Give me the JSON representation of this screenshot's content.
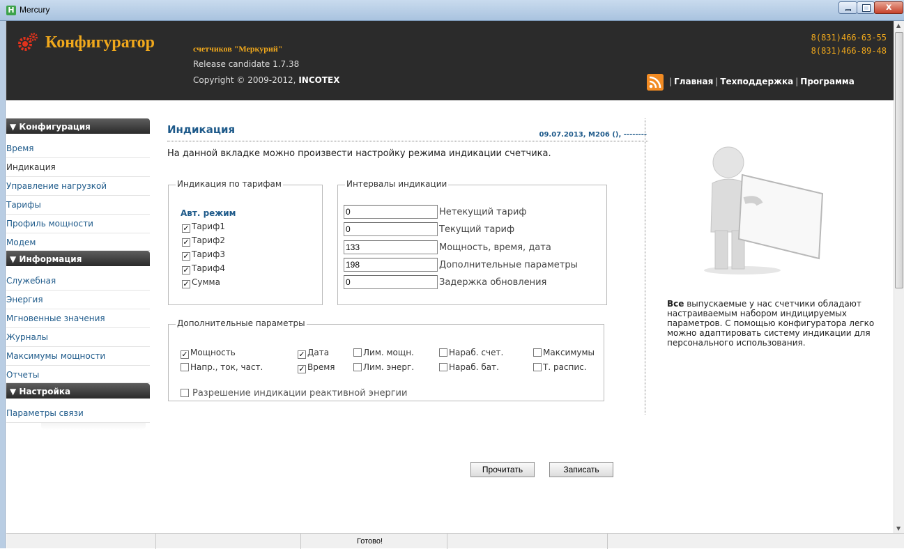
{
  "window": {
    "title": "Mercury",
    "app_icon_letter": "H"
  },
  "header": {
    "brand": "Конфигуратор",
    "brand_sub": "счетчиков \"Меркурий\"",
    "release": "Release candidate 1.7.38",
    "copyright_prefix": "Copyright © 2009-2012, ",
    "copyright_company": "INCOTEX",
    "phone1": "8(831)466-63-55",
    "phone2": "8(831)466-89-48",
    "nav": [
      "Главная",
      "Техподдержка",
      "Программа"
    ]
  },
  "sidebar": {
    "sections": [
      {
        "title": "▼ Конфигурация",
        "items": [
          "Время",
          "Индикация",
          "Управление нагрузкой",
          "Тарифы",
          "Профиль мощности",
          "Модем"
        ]
      },
      {
        "title": "▼ Информация",
        "items": [
          "Служебная",
          "Энергия",
          "Мгновенные значения",
          "Журналы",
          "Максимумы мощности",
          "Отчеты"
        ]
      },
      {
        "title": "▼ Настройка",
        "items": [
          "Параметры связи"
        ]
      }
    ],
    "active_item": "Индикация"
  },
  "main": {
    "title": "Индикация",
    "meta": "09.07.2013, M206 (), --------",
    "intro": "На данной вкладке можно произвести настройку режима индикации счетчика.",
    "tariffs": {
      "legend": "Индикация по тарифам",
      "auto_mode": "Авт. режим",
      "items": [
        {
          "label": "Тариф1",
          "checked": true
        },
        {
          "label": "Тариф2",
          "checked": true
        },
        {
          "label": "Тариф3",
          "checked": true
        },
        {
          "label": "Тариф4",
          "checked": true
        },
        {
          "label": "Сумма",
          "checked": true
        }
      ]
    },
    "intervals": {
      "legend": "Интервалы индикации",
      "rows": [
        {
          "value": "0",
          "label": "Нетекущий тариф"
        },
        {
          "value": "0",
          "label": "Текущий тариф"
        },
        {
          "value": "133",
          "label": "Мощность, время, дата"
        },
        {
          "value": "198",
          "label": "Дополнительные параметры"
        },
        {
          "value": "0",
          "label": "Задержка обновления"
        }
      ]
    },
    "extra": {
      "legend": "Дополнительные параметры",
      "items": [
        {
          "label": "Мощность",
          "checked": true
        },
        {
          "label": "Дата",
          "checked": true
        },
        {
          "label": "Лим. мощн.",
          "checked": false
        },
        {
          "label": "Нараб. счет.",
          "checked": false
        },
        {
          "label": "Максимумы",
          "checked": false
        },
        {
          "label": "Напр., ток, част.",
          "checked": false
        },
        {
          "label": "Время",
          "checked": true
        },
        {
          "label": "Лим. энерг.",
          "checked": false
        },
        {
          "label": "Нараб. бат.",
          "checked": false
        },
        {
          "label": "Т. распис.",
          "checked": false
        }
      ],
      "reactive": {
        "label": "Разрешение индикации реактивной энергии",
        "checked": false
      }
    },
    "buttons": {
      "read": "Прочитать",
      "write": "Записать"
    }
  },
  "promo": {
    "bold": "Все",
    "text": " выпускаемые у нас счетчики обладают настраиваемым набором индицируемых параметров. С помощью конфигуратора легко можно адаптировать систему индикации для персонального использования."
  },
  "status": {
    "text": "Готово!"
  },
  "colors": {
    "header_bg": "#2b2b2b",
    "brand": "#f0a81c",
    "link": "#1e5a8a"
  }
}
